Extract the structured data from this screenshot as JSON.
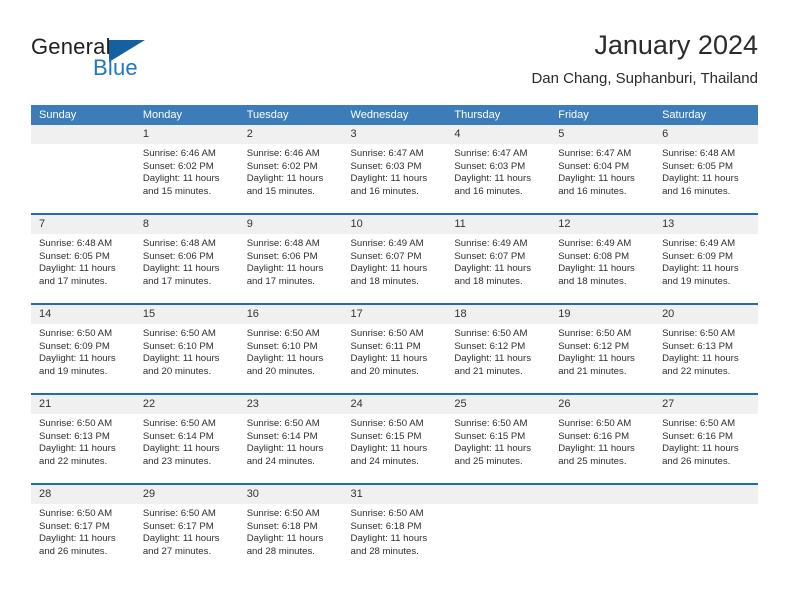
{
  "logo": {
    "word_one": "General",
    "word_two": "Blue",
    "icon": "blue-triangle-logo-icon"
  },
  "header": {
    "title": "January 2024",
    "subtitle": "Dan Chang, Suphanburi, Thailand"
  },
  "colors": {
    "header_blue": "#3b7cb9",
    "row_divider_blue": "#1f6cb0",
    "day_number_band": "#f0f0f0",
    "logo_blue": "#1f76c4",
    "logo_dark": "#231f20"
  },
  "weekdays": [
    "Sunday",
    "Monday",
    "Tuesday",
    "Wednesday",
    "Thursday",
    "Friday",
    "Saturday"
  ],
  "weeks": [
    [
      {
        "day": "",
        "empty": true,
        "lines": []
      },
      {
        "day": "1",
        "lines": [
          "Sunrise: 6:46 AM",
          "Sunset: 6:02 PM",
          "Daylight: 11 hours",
          "and 15 minutes."
        ]
      },
      {
        "day": "2",
        "lines": [
          "Sunrise: 6:46 AM",
          "Sunset: 6:02 PM",
          "Daylight: 11 hours",
          "and 15 minutes."
        ]
      },
      {
        "day": "3",
        "lines": [
          "Sunrise: 6:47 AM",
          "Sunset: 6:03 PM",
          "Daylight: 11 hours",
          "and 16 minutes."
        ]
      },
      {
        "day": "4",
        "lines": [
          "Sunrise: 6:47 AM",
          "Sunset: 6:03 PM",
          "Daylight: 11 hours",
          "and 16 minutes."
        ]
      },
      {
        "day": "5",
        "lines": [
          "Sunrise: 6:47 AM",
          "Sunset: 6:04 PM",
          "Daylight: 11 hours",
          "and 16 minutes."
        ]
      },
      {
        "day": "6",
        "lines": [
          "Sunrise: 6:48 AM",
          "Sunset: 6:05 PM",
          "Daylight: 11 hours",
          "and 16 minutes."
        ]
      }
    ],
    [
      {
        "day": "7",
        "lines": [
          "Sunrise: 6:48 AM",
          "Sunset: 6:05 PM",
          "Daylight: 11 hours",
          "and 17 minutes."
        ]
      },
      {
        "day": "8",
        "lines": [
          "Sunrise: 6:48 AM",
          "Sunset: 6:06 PM",
          "Daylight: 11 hours",
          "and 17 minutes."
        ]
      },
      {
        "day": "9",
        "lines": [
          "Sunrise: 6:48 AM",
          "Sunset: 6:06 PM",
          "Daylight: 11 hours",
          "and 17 minutes."
        ]
      },
      {
        "day": "10",
        "lines": [
          "Sunrise: 6:49 AM",
          "Sunset: 6:07 PM",
          "Daylight: 11 hours",
          "and 18 minutes."
        ]
      },
      {
        "day": "11",
        "lines": [
          "Sunrise: 6:49 AM",
          "Sunset: 6:07 PM",
          "Daylight: 11 hours",
          "and 18 minutes."
        ]
      },
      {
        "day": "12",
        "lines": [
          "Sunrise: 6:49 AM",
          "Sunset: 6:08 PM",
          "Daylight: 11 hours",
          "and 18 minutes."
        ]
      },
      {
        "day": "13",
        "lines": [
          "Sunrise: 6:49 AM",
          "Sunset: 6:09 PM",
          "Daylight: 11 hours",
          "and 19 minutes."
        ]
      }
    ],
    [
      {
        "day": "14",
        "lines": [
          "Sunrise: 6:50 AM",
          "Sunset: 6:09 PM",
          "Daylight: 11 hours",
          "and 19 minutes."
        ]
      },
      {
        "day": "15",
        "lines": [
          "Sunrise: 6:50 AM",
          "Sunset: 6:10 PM",
          "Daylight: 11 hours",
          "and 20 minutes."
        ]
      },
      {
        "day": "16",
        "lines": [
          "Sunrise: 6:50 AM",
          "Sunset: 6:10 PM",
          "Daylight: 11 hours",
          "and 20 minutes."
        ]
      },
      {
        "day": "17",
        "lines": [
          "Sunrise: 6:50 AM",
          "Sunset: 6:11 PM",
          "Daylight: 11 hours",
          "and 20 minutes."
        ]
      },
      {
        "day": "18",
        "lines": [
          "Sunrise: 6:50 AM",
          "Sunset: 6:12 PM",
          "Daylight: 11 hours",
          "and 21 minutes."
        ]
      },
      {
        "day": "19",
        "lines": [
          "Sunrise: 6:50 AM",
          "Sunset: 6:12 PM",
          "Daylight: 11 hours",
          "and 21 minutes."
        ]
      },
      {
        "day": "20",
        "lines": [
          "Sunrise: 6:50 AM",
          "Sunset: 6:13 PM",
          "Daylight: 11 hours",
          "and 22 minutes."
        ]
      }
    ],
    [
      {
        "day": "21",
        "lines": [
          "Sunrise: 6:50 AM",
          "Sunset: 6:13 PM",
          "Daylight: 11 hours",
          "and 22 minutes."
        ]
      },
      {
        "day": "22",
        "lines": [
          "Sunrise: 6:50 AM",
          "Sunset: 6:14 PM",
          "Daylight: 11 hours",
          "and 23 minutes."
        ]
      },
      {
        "day": "23",
        "lines": [
          "Sunrise: 6:50 AM",
          "Sunset: 6:14 PM",
          "Daylight: 11 hours",
          "and 24 minutes."
        ]
      },
      {
        "day": "24",
        "lines": [
          "Sunrise: 6:50 AM",
          "Sunset: 6:15 PM",
          "Daylight: 11 hours",
          "and 24 minutes."
        ]
      },
      {
        "day": "25",
        "lines": [
          "Sunrise: 6:50 AM",
          "Sunset: 6:15 PM",
          "Daylight: 11 hours",
          "and 25 minutes."
        ]
      },
      {
        "day": "26",
        "lines": [
          "Sunrise: 6:50 AM",
          "Sunset: 6:16 PM",
          "Daylight: 11 hours",
          "and 25 minutes."
        ]
      },
      {
        "day": "27",
        "lines": [
          "Sunrise: 6:50 AM",
          "Sunset: 6:16 PM",
          "Daylight: 11 hours",
          "and 26 minutes."
        ]
      }
    ],
    [
      {
        "day": "28",
        "lines": [
          "Sunrise: 6:50 AM",
          "Sunset: 6:17 PM",
          "Daylight: 11 hours",
          "and 26 minutes."
        ]
      },
      {
        "day": "29",
        "lines": [
          "Sunrise: 6:50 AM",
          "Sunset: 6:17 PM",
          "Daylight: 11 hours",
          "and 27 minutes."
        ]
      },
      {
        "day": "30",
        "lines": [
          "Sunrise: 6:50 AM",
          "Sunset: 6:18 PM",
          "Daylight: 11 hours",
          "and 28 minutes."
        ]
      },
      {
        "day": "31",
        "lines": [
          "Sunrise: 6:50 AM",
          "Sunset: 6:18 PM",
          "Daylight: 11 hours",
          "and 28 minutes."
        ]
      },
      {
        "day": "",
        "empty": true,
        "lines": []
      },
      {
        "day": "",
        "empty": true,
        "lines": []
      },
      {
        "day": "",
        "empty": true,
        "lines": []
      }
    ]
  ]
}
